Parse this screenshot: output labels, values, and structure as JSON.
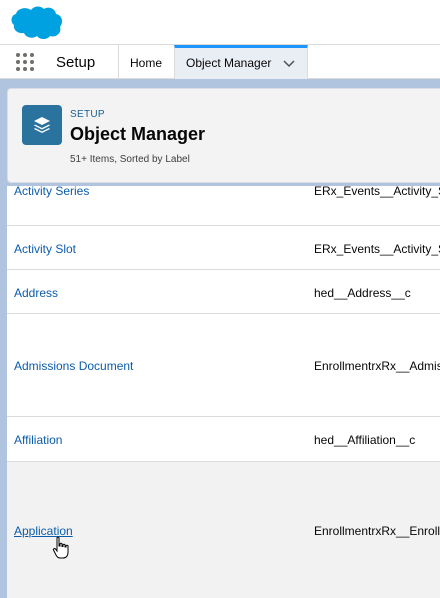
{
  "header": {
    "logo_icon": "salesforce-cloud-logo",
    "app_launcher_icon": "waffle-icon",
    "app_name": "Setup",
    "tabs": [
      {
        "label": "Home"
      },
      {
        "label": "Object Manager",
        "active": true
      }
    ]
  },
  "page_header": {
    "icon": "layers-icon",
    "eyebrow": "SETUP",
    "title": "Object Manager",
    "subtitle": "51+ Items, Sorted by Label"
  },
  "rows": [
    {
      "label": "Activity Series",
      "api_name": "ERx_Events__Activity_Se"
    },
    {
      "label": "Activity Slot",
      "api_name": "ERx_Events__Activity_Slo"
    },
    {
      "label": "Address",
      "api_name": "hed__Address__c"
    },
    {
      "label": "Admissions Document",
      "api_name": "EnrollmentrxRx__Admis"
    },
    {
      "label": "Affiliation",
      "api_name": "hed__Affiliation__c"
    },
    {
      "label": "Application",
      "api_name": "EnrollmentrxRx__Enroll"
    }
  ],
  "colors": {
    "brand_blue": "#00a1e0",
    "link": "#0b5cab",
    "active_tab_accent": "#1b96ff",
    "icon_bg": "#2a739e",
    "background": "#b0c4df"
  }
}
